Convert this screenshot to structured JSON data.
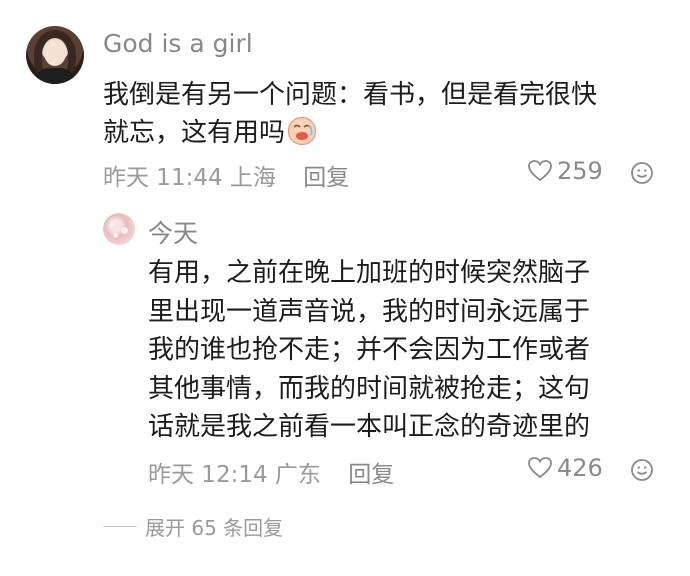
{
  "comment": {
    "username": "God is a girl",
    "text_line1": "我倒是有另一个问题：看书，但是看完很快",
    "text_line2": "就忘，这有用吗",
    "emoji_name": "sad-face-emoji",
    "time": "昨天 11:44",
    "location": "上海",
    "reply_label": "回复",
    "likes": "259"
  },
  "reply": {
    "username": "今天",
    "lines": [
      "有用，之前在晚上加班的时候突然脑子",
      "里出现一道声音说，我的时间永远属于",
      "我的谁也抢不走；并不会因为工作或者",
      "其他事情，而我的时间就被抢走；这句",
      "话就是我之前看一本叫正念的奇迹里的"
    ],
    "time": "昨天 12:14",
    "location": "广东",
    "reply_label": "回复",
    "likes": "426"
  },
  "expand": {
    "label": "展开 65 条回复"
  },
  "icons": {
    "like": "heart-outline-icon",
    "react": "smile-face-icon"
  },
  "colors": {
    "meta_gray": "#9a9a9a",
    "text": "#1c1c1c"
  }
}
